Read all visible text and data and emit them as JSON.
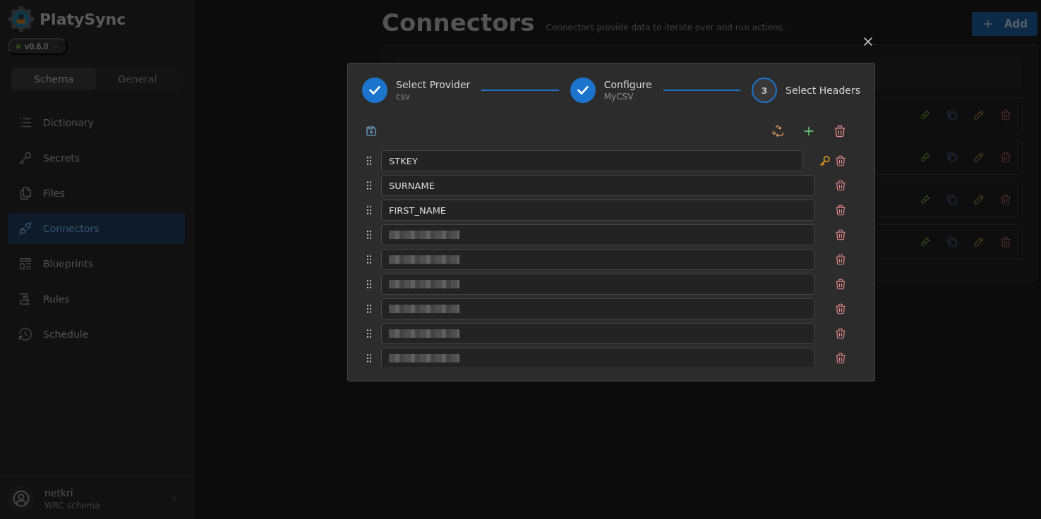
{
  "app": {
    "name": "PlatySync",
    "version": "v0.6.0"
  },
  "sidebar": {
    "tabs": [
      {
        "label": "Schema",
        "selected": true
      },
      {
        "label": "General",
        "selected": false
      }
    ],
    "items": [
      {
        "label": "Dictionary",
        "selected": false
      },
      {
        "label": "Secrets",
        "selected": false
      },
      {
        "label": "Files",
        "selected": false
      },
      {
        "label": "Connectors",
        "selected": true
      },
      {
        "label": "Blueprints",
        "selected": false
      },
      {
        "label": "Rules",
        "selected": false
      },
      {
        "label": "Schedule",
        "selected": false
      }
    ],
    "user": {
      "name": "netkri",
      "subtitle": "WRC schema"
    }
  },
  "page": {
    "title": "Connectors",
    "subtitle": "Connectors provide data to iterate over and run actions.",
    "add_button": "Add"
  },
  "modal": {
    "steps": [
      {
        "title": "Select Provider",
        "subtitle": "csv",
        "completed": true
      },
      {
        "title": "Configure",
        "subtitle": "MyCSV",
        "completed": true
      },
      {
        "title": "Select Headers",
        "number": "3",
        "completed": false
      }
    ],
    "headers": [
      {
        "value": "STKEY",
        "primary_key": true,
        "redacted": false
      },
      {
        "value": "SURNAME",
        "primary_key": false,
        "redacted": false
      },
      {
        "value": "FIRST_NAME",
        "primary_key": false,
        "redacted": false
      },
      {
        "primary_key": false,
        "redacted": true
      },
      {
        "primary_key": false,
        "redacted": true
      },
      {
        "primary_key": false,
        "redacted": true
      },
      {
        "primary_key": false,
        "redacted": true
      },
      {
        "primary_key": false,
        "redacted": true
      },
      {
        "primary_key": false,
        "redacted": true
      }
    ]
  }
}
